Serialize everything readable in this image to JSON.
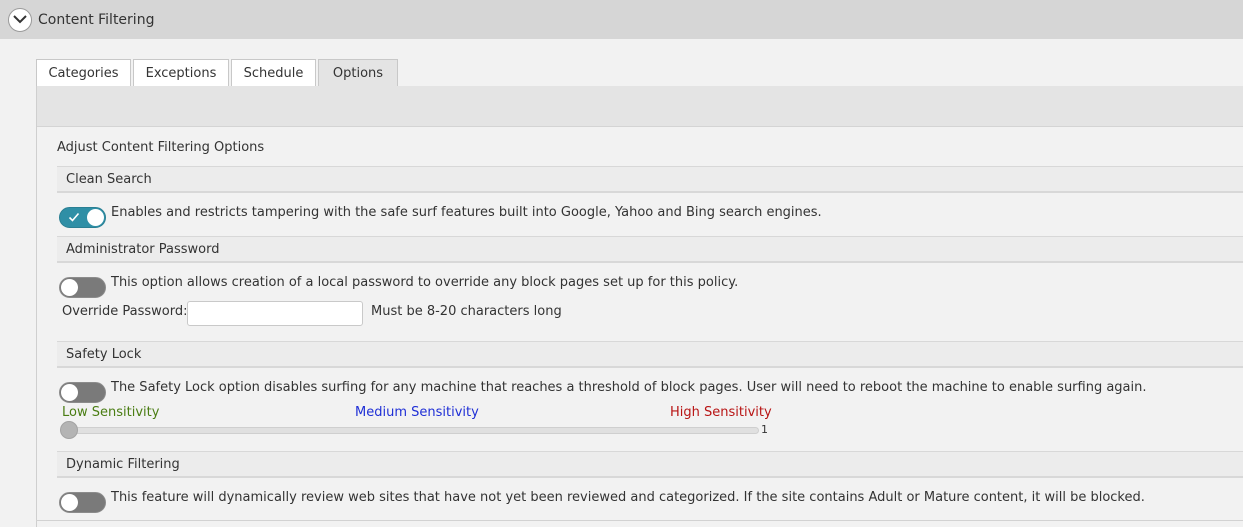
{
  "header": {
    "title": "Content Filtering",
    "collapse_icon": "chevron-down-icon"
  },
  "tabs": [
    {
      "label": "Categories",
      "active": false
    },
    {
      "label": "Exceptions",
      "active": false
    },
    {
      "label": "Schedule",
      "active": false
    },
    {
      "label": "Options",
      "active": true
    }
  ],
  "panel_title": "Adjust Content Filtering Options",
  "sections": {
    "clean_search": {
      "title": "Clean Search",
      "enabled": true,
      "description": "Enables and restricts tampering with the safe surf features built into Google, Yahoo and Bing search engines."
    },
    "admin_password": {
      "title": "Administrator Password",
      "enabled": false,
      "description": "This option allows creation of a local password to override any block pages set up for this policy.",
      "field_label": "Override Password:",
      "field_value": "",
      "field_hint": "Must be 8-20 characters long"
    },
    "safety_lock": {
      "title": "Safety Lock",
      "enabled": false,
      "description": "The Safety Lock option disables surfing for any machine that reaches a threshold of block pages. User will need to reboot the machine to enable surfing again.",
      "low_label": "Low Sensitivity",
      "medium_label": "Medium Sensitivity",
      "high_label": "High Sensitivity",
      "slider_value": "1",
      "colors": {
        "low": "#4a7d13",
        "medium": "#1f2fd6",
        "high": "#b81414"
      }
    },
    "dynamic_filtering": {
      "title": "Dynamic Filtering",
      "enabled": false,
      "description": "This feature will dynamically review web sites that have not yet been reviewed and categorized. If the site contains Adult or Mature content, it will be blocked."
    }
  },
  "colors": {
    "toggle_on": "#2f8fa6",
    "toggle_off": "#7a7a7a",
    "header_bg": "#d6d6d6"
  }
}
